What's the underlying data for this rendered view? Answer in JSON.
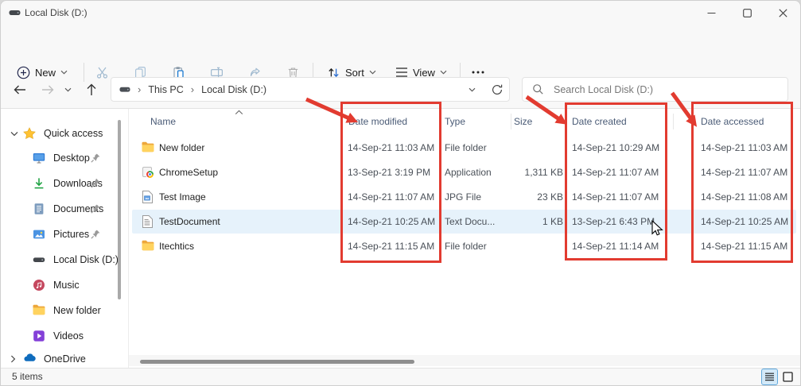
{
  "window": {
    "title": "Local Disk (D:)"
  },
  "toolbar": {
    "new_label": "New",
    "sort_label": "Sort",
    "view_label": "View",
    "icons": [
      "new-icon",
      "cut-icon",
      "copy-icon",
      "paste-icon",
      "rename-icon",
      "share-icon",
      "delete-icon",
      "sort-icon",
      "view-icon",
      "more-icon"
    ]
  },
  "nav": {
    "icons": [
      "back-icon",
      "forward-icon",
      "recent-locations-chevron-icon",
      "up-icon",
      "address-chevron-icon",
      "refresh-icon"
    ],
    "breadcrumb": {
      "root": "This PC",
      "current": "Local Disk (D:)"
    }
  },
  "search": {
    "placeholder": "Search Local Disk (D:)",
    "icon": "search-icon"
  },
  "columns": {
    "name": "Name",
    "date_modified": "Date modified",
    "type": "Type",
    "size": "Size",
    "date_created": "Date created",
    "date_accessed": "Date accessed"
  },
  "files": {
    "rows": [
      {
        "name": "New folder",
        "icon": "folder-icon",
        "date_modified": "14-Sep-21 11:03 AM",
        "type": "File folder",
        "size": "",
        "date_created": "14-Sep-21 10:29 AM",
        "date_accessed": "14-Sep-21 11:03 AM"
      },
      {
        "name": "ChromeSetup",
        "icon": "chrome-installer-icon",
        "date_modified": "13-Sep-21 3:19 PM",
        "type": "Application",
        "size": "1,311 KB",
        "date_created": "14-Sep-21 11:07 AM",
        "date_accessed": "14-Sep-21 11:07 AM"
      },
      {
        "name": "Test Image",
        "icon": "image-file-icon",
        "date_modified": "14-Sep-21 11:07 AM",
        "type": "JPG File",
        "size": "23 KB",
        "date_created": "14-Sep-21 11:07 AM",
        "date_accessed": "14-Sep-21 11:08 AM"
      },
      {
        "name": "TestDocument",
        "icon": "text-file-icon",
        "date_modified": "14-Sep-21 10:25 AM",
        "type": "Text Docu...",
        "size": "1 KB",
        "date_created": "13-Sep-21 6:43 PM",
        "date_accessed": "14-Sep-21 10:25 AM"
      },
      {
        "name": "Itechtics",
        "icon": "folder-icon",
        "date_modified": "14-Sep-21 11:15 AM",
        "type": "File folder",
        "size": "",
        "date_created": "14-Sep-21 11:14 AM",
        "date_accessed": "14-Sep-21 11:15 AM"
      }
    ],
    "selected_row": "TestDocument"
  },
  "sidebar": {
    "quick_access": "Quick access",
    "items": [
      {
        "label": "Desktop",
        "icon": "desktop-icon",
        "pinned": true
      },
      {
        "label": "Downloads",
        "icon": "downloads-icon",
        "pinned": true
      },
      {
        "label": "Documents",
        "icon": "documents-icon",
        "pinned": true
      },
      {
        "label": "Pictures",
        "icon": "pictures-icon",
        "pinned": true
      },
      {
        "label": "Local Disk (D:)",
        "icon": "disk-icon",
        "pinned": false
      },
      {
        "label": "Music",
        "icon": "music-icon",
        "pinned": false
      },
      {
        "label": "New folder",
        "icon": "folder-icon",
        "pinned": false
      },
      {
        "label": "Videos",
        "icon": "videos-icon",
        "pinned": false
      }
    ],
    "onedrive": "OneDrive"
  },
  "statusbar": {
    "count": "5 items",
    "view_toggles": [
      "details-view-icon",
      "thumbnail-view-icon"
    ]
  },
  "annotations": {
    "color": "#e23b30",
    "boxed_columns": [
      "Date modified",
      "Date created",
      "Date accessed"
    ]
  }
}
